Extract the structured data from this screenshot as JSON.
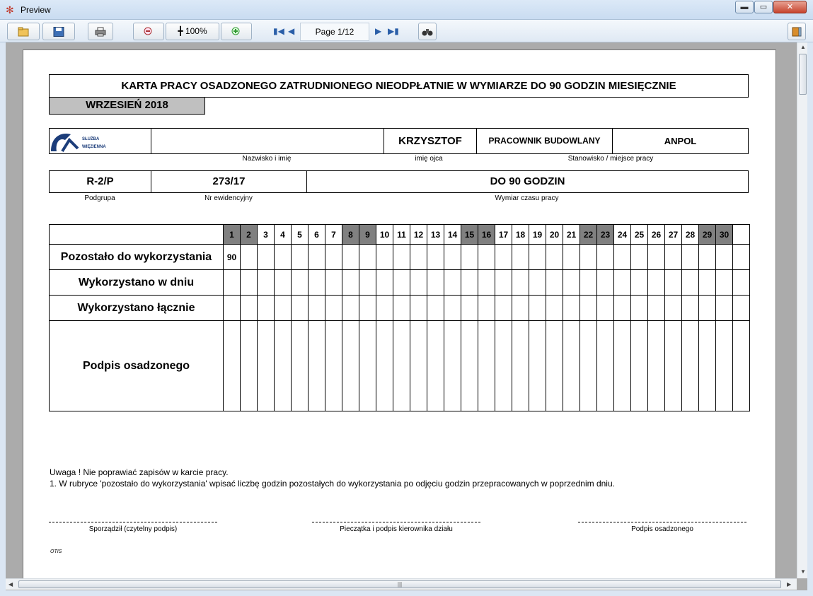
{
  "window": {
    "title": "Preview",
    "app_icon": "gear-icon",
    "min_label": "▬",
    "max_label": "▭",
    "close_label": "✕"
  },
  "toolbar": {
    "open_icon": "open-folder-icon",
    "save_icon": "save-disk-icon",
    "print_icon": "printer-icon",
    "zoom_out_icon": "zoom-out-icon",
    "zoom_label": "100%",
    "zoom_in_icon": "zoom-in-icon",
    "page_indicator": "Page 1/12",
    "find_icon": "binoculars-icon",
    "exit_icon": "exit-door-icon"
  },
  "document": {
    "title": "KARTA PRACY OSADZONEGO ZATRUDNIONEGO NIEODPŁATNIE W WYMIARZE DO 90 GODZIN MIESIĘCZNIE",
    "month": "WRZESIEŃ 2018",
    "logo_text_1": "SŁUŻBA",
    "logo_text_2": "WIĘZIENNA",
    "row1": {
      "name_value": "",
      "father_name": "KRZYSZTOF",
      "position": "PRACOWNIK BUDOWLANY",
      "workplace": "ANPOL",
      "label_name": "Nazwisko i imię",
      "label_father": "imię ojca",
      "label_position": "Stanowisko / miejsce pracy"
    },
    "row2": {
      "subgroup": "R-2/P",
      "record_no": "273/17",
      "work_time": "DO 90 GODZIN",
      "label_subgroup": "Podgrupa",
      "label_record": "Nr ewidencyjny",
      "label_work_time": "Wymiar czasu pracy"
    },
    "grid": {
      "days": [
        "1",
        "2",
        "3",
        "4",
        "5",
        "6",
        "7",
        "8",
        "9",
        "10",
        "11",
        "12",
        "13",
        "14",
        "15",
        "16",
        "17",
        "18",
        "19",
        "20",
        "21",
        "22",
        "23",
        "24",
        "25",
        "26",
        "27",
        "28",
        "29",
        "30",
        ""
      ],
      "dark_days": [
        1,
        2,
        8,
        9,
        15,
        16,
        22,
        23,
        29,
        30
      ],
      "rows": [
        {
          "label": "Pozostało do wykorzystania",
          "first_value": "90"
        },
        {
          "label": "Wykorzystano w dniu",
          "first_value": ""
        },
        {
          "label": "Wykorzystano łącznie",
          "first_value": ""
        },
        {
          "label": "Podpis osadzonego",
          "first_value": ""
        }
      ]
    },
    "notes": {
      "line1": "Uwaga ! Nie poprawiać zapisów w karcie pracy.",
      "line2": "1. W rubryce 'pozostało do wykorzystania' wpisać liczbę godzin pozostałych do wykorzystania po odjęciu godzin przepracowanych w poprzednim dniu."
    },
    "signatures": {
      "sig1": "Sporządził (czytelny podpis)",
      "sig2": "Pieczątka i podpis kierownika działu",
      "sig3": "Podpis osadzonego"
    },
    "footer": "OTIS"
  }
}
